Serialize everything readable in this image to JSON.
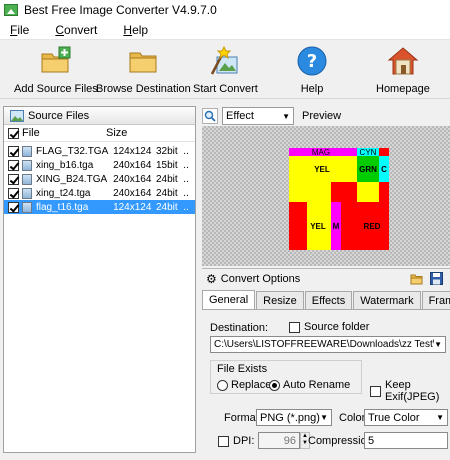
{
  "window": {
    "title": "Best Free Image Converter V4.9.7.0"
  },
  "menu": [
    {
      "accel": "F",
      "rest": "ile"
    },
    {
      "accel": "C",
      "rest": "onvert"
    },
    {
      "accel": "H",
      "rest": "elp"
    }
  ],
  "toolbar": {
    "add_source": "Add Source Files",
    "browse_dest": "Browse Destination",
    "start_convert": "Start Convert",
    "help": "Help",
    "homepage": "Homepage"
  },
  "source_panel": {
    "title": "Source Files",
    "col_file": "File",
    "col_size": "Size",
    "files": [
      {
        "name": "FLAG_T32.TGA",
        "dim": "124x124",
        "bits": "32bit",
        "more": "..",
        "checked": true,
        "selected": false
      },
      {
        "name": "xing_b16.tga",
        "dim": "240x164",
        "bits": "15bit",
        "more": "..",
        "checked": true,
        "selected": false
      },
      {
        "name": "XING_B24.TGA",
        "dim": "240x164",
        "bits": "24bit",
        "more": "..",
        "checked": true,
        "selected": false
      },
      {
        "name": "xing_t24.tga",
        "dim": "240x164",
        "bits": "24bit",
        "more": "..",
        "checked": true,
        "selected": false
      },
      {
        "name": "flag_t16.tga",
        "dim": "124x124",
        "bits": "24bit",
        "more": "..",
        "checked": true,
        "selected": true
      }
    ]
  },
  "effect": {
    "value": "Effect",
    "preview_label": "Preview"
  },
  "preview_image": {
    "labels": {
      "mag": "MAG",
      "cyn": "CYN",
      "yel": "YEL",
      "grn": "GRN",
      "c": "C",
      "yel2": "YEL",
      "m": "M",
      "red": "RED"
    }
  },
  "options": {
    "title": "Convert Options",
    "tabs": [
      "General",
      "Resize",
      "Effects",
      "Watermark",
      "Frame"
    ],
    "destination_label": "Destination:",
    "source_folder_label": "Source folder",
    "destination_path": "C:\\Users\\LISTOFFREEWARE\\Downloads\\zz Test\\New fo",
    "file_exists_label": "File Exists",
    "replace_label": "Replace",
    "auto_rename_label": "Auto Rename",
    "keep_exif_label": "Keep Exif(JPEG)",
    "format_label": "Format:",
    "format_value": "PNG (*.png)",
    "color_label": "Color:",
    "color_value": "True Color",
    "dpi_label": "DPI:",
    "dpi_value": "96",
    "compression_label": "Compression:",
    "compression_value": "5"
  },
  "colors": {
    "selection": "#3399ff",
    "yellow": "#ffff00",
    "red": "#ff0000",
    "magenta": "#ff00ff",
    "cyan": "#00ffff",
    "green": "#00cc00"
  }
}
